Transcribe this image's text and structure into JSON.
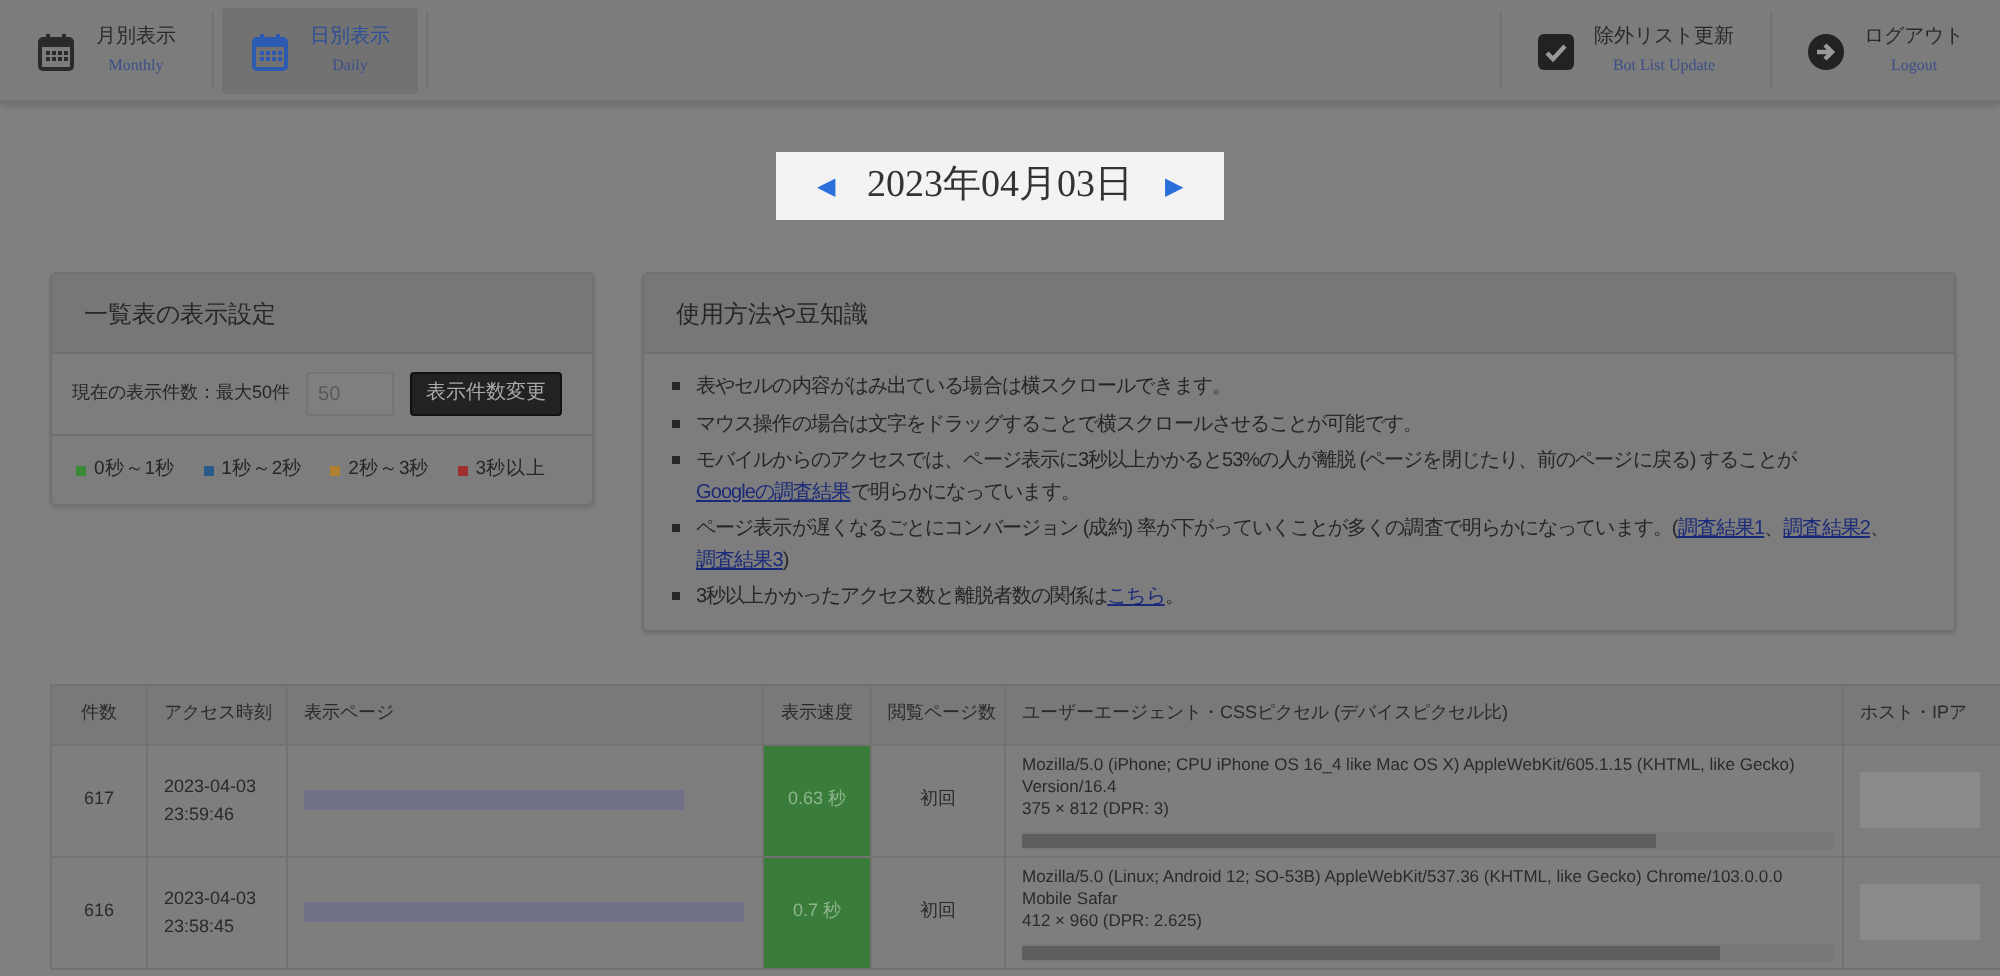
{
  "nav_left": [
    {
      "title": "月別表示",
      "subtitle": "Monthly",
      "selected": false
    },
    {
      "title": "日別表示",
      "subtitle": "Daily",
      "selected": true
    }
  ],
  "nav_right": [
    {
      "title": "除外リスト更新",
      "subtitle": "Bot List Update"
    },
    {
      "title": "ログアウト",
      "subtitle": "Logout"
    }
  ],
  "date_nav": {
    "prev": "◀",
    "date": "2023年04月03日",
    "next": "▶"
  },
  "settings": {
    "title": "一覧表の表示設定",
    "count_label": "現在の表示件数：最大50件",
    "count_placeholder": "50",
    "button": "表示件数変更",
    "legend": [
      {
        "label": "0秒～1秒",
        "color": "#3a8a3a"
      },
      {
        "label": "1秒～2秒",
        "color": "#2a5a8a"
      },
      {
        "label": "2秒～3秒",
        "color": "#b08030"
      },
      {
        "label": "3秒以上",
        "color": "#a03030"
      }
    ]
  },
  "tips": {
    "title": "使用方法や豆知識",
    "items": [
      {
        "parts": [
          {
            "kind": "text",
            "text": "表やセルの内容がはみ出ている場合は横スクロールできます。"
          }
        ]
      },
      {
        "parts": [
          {
            "kind": "text",
            "text": "マウス操作の場合は文字をドラッグすることで横スクロールさせることが可能です。"
          }
        ]
      },
      {
        "parts": [
          {
            "kind": "text",
            "text": "モバイルからのアクセスでは、ページ表示に3秒以上かかると53%の人が離脱 (ページを閉じたり、前のページに戻る) することが"
          },
          {
            "kind": "link",
            "text": "Googleの調査結果"
          },
          {
            "kind": "text",
            "text": "で明らかになっています。"
          }
        ]
      },
      {
        "parts": [
          {
            "kind": "text",
            "text": "ページ表示が遅くなるごとにコンバージョン (成約) 率が下がっていくことが多くの調査で明らかになっています。("
          },
          {
            "kind": "link",
            "text": "調査結果1"
          },
          {
            "kind": "text",
            "text": "、"
          },
          {
            "kind": "link",
            "text": "調査結果2"
          },
          {
            "kind": "text",
            "text": "、"
          },
          {
            "kind": "link",
            "text": "調査結果3"
          },
          {
            "kind": "text",
            "text": ")"
          }
        ]
      },
      {
        "parts": [
          {
            "kind": "text",
            "text": "3秒以上かかったアクセス数と離脱者数の関係は"
          },
          {
            "kind": "link",
            "text": "こちら"
          },
          {
            "kind": "text",
            "text": "。"
          }
        ]
      }
    ]
  },
  "table": {
    "columns": [
      "件数",
      "アクセス時刻",
      "表示ページ",
      "表示速度",
      "閲覧ページ数",
      "ユーザーエージェント・CSSピクセル (デバイスピクセル比)",
      "ホスト・IPア"
    ],
    "rows": [
      {
        "count": "617",
        "time": "2023-04-03 23:59:46",
        "speed": "0.63 秒",
        "color": "#3a7d3a",
        "views": "初回",
        "ua": "Mozilla/5.0 (iPhone; CPU iPhone OS 16_4 like Mac OS X) AppleWebKit/605.1.15 (KHTML, like Gecko) Version/16.4",
        "screen": "375 × 812  (DPR: 3)"
      },
      {
        "count": "616",
        "time": "2023-04-03 23:58:45",
        "speed": "0.7 秒",
        "color": "#3a7d3a",
        "views": "初回",
        "ua": "Mozilla/5.0 (Linux; Android 12; SO-53B) AppleWebKit/537.36 (KHTML, like Gecko) Chrome/103.0.0.0 Mobile Safar",
        "screen": "412 × 960  (DPR: 2.625)"
      }
    ]
  }
}
